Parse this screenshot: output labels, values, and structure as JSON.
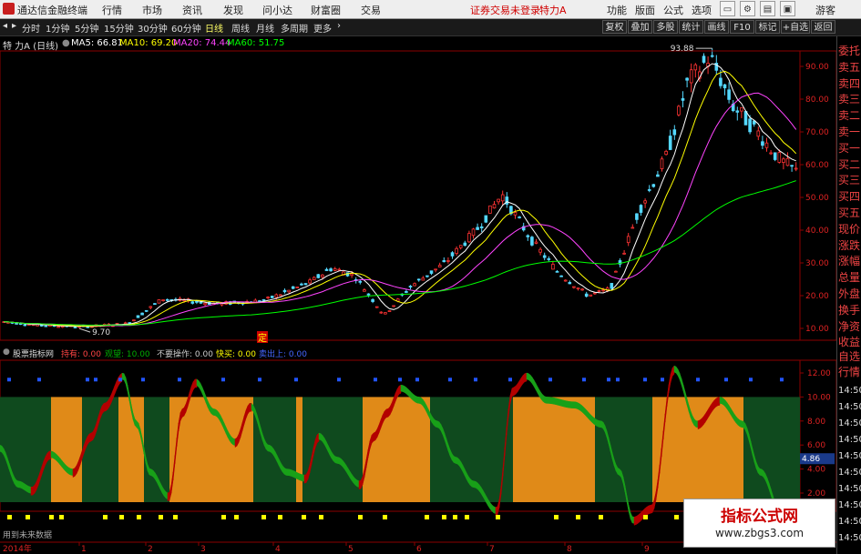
{
  "titlebar": {
    "app_name": "通达信金融终端",
    "menus": [
      "行情",
      "市场",
      "资讯",
      "发现",
      "问小达",
      "财富圈",
      "交易"
    ],
    "warning": "证券交易未登录",
    "stock": "特力A",
    "right_menus": [
      "功能",
      "版面",
      "公式",
      "选项"
    ],
    "guest": "游客"
  },
  "toolbar": {
    "periods": [
      "分时",
      "1分钟",
      "5分钟",
      "15分钟",
      "30分钟",
      "60分钟",
      "日线",
      "周线",
      "月线",
      "多周期",
      "更多"
    ],
    "active_period": "日线",
    "right_buttons": [
      "复权",
      "叠加",
      "多股",
      "统计",
      "画线",
      "F10",
      "标记",
      "+自选",
      "返回"
    ]
  },
  "main_chart": {
    "title": "特 力A (日线)",
    "ma_labels": [
      "MA5: 66.81",
      "MA10: 69.20",
      "MA20: 74.44",
      "MA60: 51.75"
    ],
    "ma_colors": [
      "#ffffff",
      "#ffff00",
      "#ff44ff",
      "#00ff00"
    ],
    "y_ticks": [
      "90.00",
      "80.00",
      "70.00",
      "60.00",
      "50.00",
      "40.00",
      "30.00",
      "20.00",
      "10.00"
    ],
    "high_label": "93.88",
    "low_label": "9.70",
    "marker": "定"
  },
  "indicator": {
    "title": "股票指标网",
    "items": [
      {
        "label": "持有: 0.00",
        "color": "#ff4444"
      },
      {
        "label": "观望: 10.00",
        "color": "#00aa00"
      },
      {
        "label": "不要操作: 0.00",
        "color": "#cccccc"
      },
      {
        "label": "快买: 0.00",
        "color": "#ffff00"
      },
      {
        "label": "卖出上: 0.00",
        "color": "#4466ff"
      }
    ],
    "y_ticks": [
      "12.00",
      "10.00",
      "8.00",
      "6.00",
      "4.00",
      "2.00"
    ],
    "current_value": "4.86"
  },
  "right_panel": {
    "tabs": [
      "委托",
      "卖五",
      "卖四",
      "卖三",
      "卖二",
      "卖一",
      "买一",
      "买二",
      "买三",
      "买四",
      "买五",
      "现价",
      "涨跌",
      "涨幅",
      "总量",
      "外盘",
      "换手",
      "净资",
      "收益"
    ],
    "tab2": [
      "自选",
      "行情"
    ],
    "times": [
      "14:50",
      "14:50",
      "14:50",
      "14:50",
      "14:50",
      "14:50",
      "14:50",
      "14:50",
      "14:50",
      "14:50"
    ]
  },
  "bottom": {
    "note": "用到未来数据",
    "year": "2014年",
    "months": [
      "1",
      "2",
      "3",
      "4",
      "5",
      "6",
      "7",
      "8",
      "9"
    ]
  },
  "watermark": {
    "line1": "指标公式网",
    "line2": "www.zbgs3.com"
  }
}
